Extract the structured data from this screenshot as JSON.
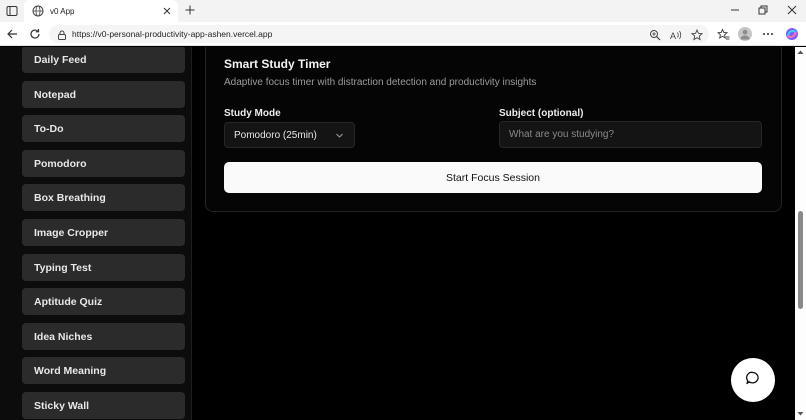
{
  "browser": {
    "tab_title": "v0 App",
    "url": "https://v0-personal-productivity-app-ashen.vercel.app",
    "icons": {
      "tab_actions": "tab-actions-icon",
      "favicon": "globe-icon",
      "tab_close": "close-icon",
      "new_tab": "plus-icon",
      "minimize": "minimize-icon",
      "restore": "restore-icon",
      "close_window": "close-icon",
      "back": "back-arrow-icon",
      "refresh": "refresh-icon",
      "site_info": "lock-icon",
      "zoom": "zoom-icon",
      "read_aloud": "read-aloud-icon",
      "favorite": "star-icon",
      "favorites_bar": "favorites-icon",
      "profile": "profile-icon",
      "more": "more-icon",
      "copilot": "copilot-icon"
    }
  },
  "sidebar": {
    "items": [
      {
        "label": "Daily Feed"
      },
      {
        "label": "Notepad"
      },
      {
        "label": "To-Do"
      },
      {
        "label": "Pomodoro"
      },
      {
        "label": "Box Breathing"
      },
      {
        "label": "Image Cropper"
      },
      {
        "label": "Typing Test"
      },
      {
        "label": "Aptitude Quiz"
      },
      {
        "label": "Idea Niches"
      },
      {
        "label": "Word Meaning"
      },
      {
        "label": "Sticky Wall"
      }
    ]
  },
  "timer": {
    "title": "Smart Study Timer",
    "description": "Adaptive focus timer with distraction detection and productivity insights",
    "study_mode_label": "Study Mode",
    "study_mode_value": "Pomodoro (25min)",
    "subject_label": "Subject (optional)",
    "subject_placeholder": "What are you studying?",
    "subject_value": "",
    "start_button": "Start Focus Session"
  },
  "chat": {
    "icon": "chat-bubble-icon"
  },
  "colors": {
    "page_bg": "#000000",
    "sidebar_button_bg": "#2b2b2b",
    "primary_button_bg": "#fafafa",
    "copilot_accent": "#7b5cff"
  }
}
